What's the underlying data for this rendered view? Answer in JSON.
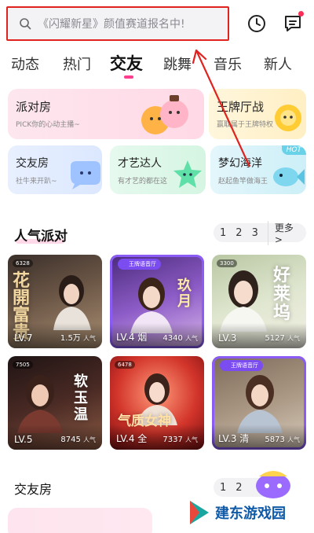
{
  "search": {
    "text": "《闪耀新星》颜值赛道报名中!"
  },
  "tabs": [
    {
      "label": "动态"
    },
    {
      "label": "热门"
    },
    {
      "label": "交友",
      "active": true
    },
    {
      "label": "跳舞"
    },
    {
      "label": "音乐"
    },
    {
      "label": "新人"
    }
  ],
  "features": {
    "party": {
      "title": "派对房",
      "sub": "PICK你的心动主播~"
    },
    "king": {
      "title": "王牌厅战",
      "sub": "赢取属于王牌特权"
    },
    "friend": {
      "title": "交友房",
      "sub": "社牛来开趴~"
    },
    "talent": {
      "title": "才艺达人",
      "sub": "有才艺的都在这"
    },
    "ocean": {
      "title": "梦幻海洋",
      "sub": "赵起鱼竿做海王",
      "hot": "HOT"
    }
  },
  "popular": {
    "title": "人气派对",
    "pager": [
      "1",
      "2",
      "3"
    ],
    "more": "更多 >"
  },
  "rooms": [
    {
      "lv": "LV.7",
      "pop": "1.5万",
      "unit": "人气",
      "id": "6328",
      "bigtext": "花開富贵"
    },
    {
      "lv": "LV.4 烟",
      "pop": "4340",
      "unit": "人气",
      "badge": "王牌语音厅",
      "bigtext": "玖月"
    },
    {
      "lv": "LV.3",
      "pop": "5127",
      "unit": "人气",
      "id": "3300",
      "bigtext": "好莱坞"
    },
    {
      "lv": "LV.5",
      "pop": "8745",
      "unit": "人气",
      "id": "7505",
      "bigtext": "软玉温"
    },
    {
      "lv": "LV.4 全",
      "pop": "7337",
      "unit": "人气",
      "id": "6478",
      "bigtext": "气质女神"
    },
    {
      "lv": "LV.3 清",
      "pop": "5873",
      "unit": "人气",
      "badge": "王牌语音厅"
    }
  ],
  "friends_section": {
    "title": "交友房",
    "pager": [
      "1",
      "2"
    ]
  },
  "watermark": {
    "text": "建东游戏园"
  },
  "colors": {
    "accent": "#ff3c8e",
    "annotation": "#e0231f",
    "badge": "#7b4cf0"
  }
}
